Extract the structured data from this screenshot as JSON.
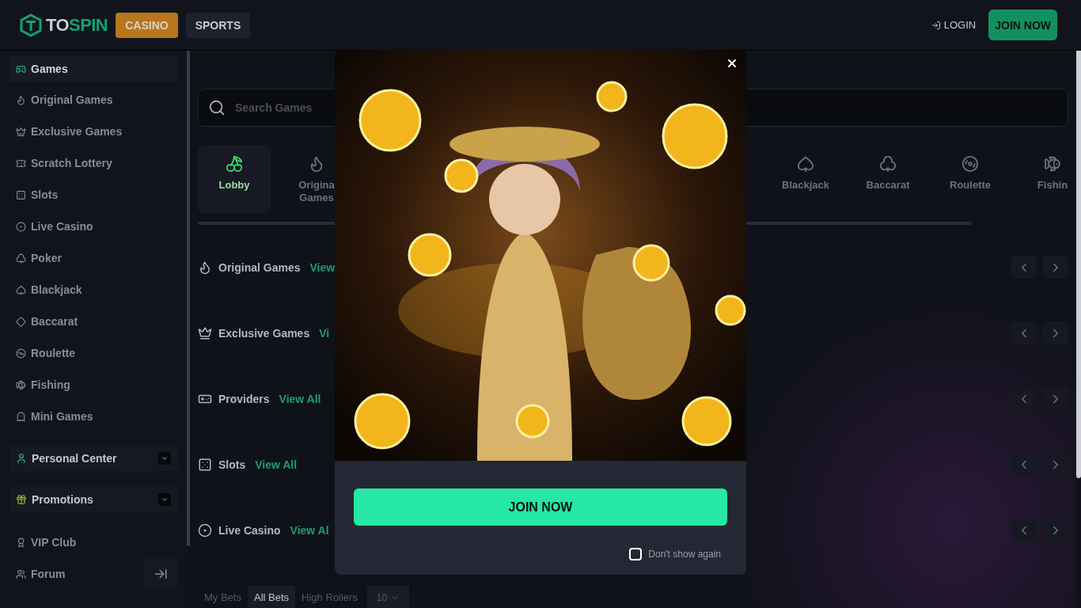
{
  "header": {
    "logo": {
      "parts": [
        "TO",
        "SPIN"
      ]
    },
    "nav": [
      {
        "label": "CASINO",
        "selected": true
      },
      {
        "label": "SPORTS",
        "selected": false
      }
    ],
    "login": "LOGIN",
    "join": "JOIN NOW"
  },
  "sidebar": {
    "items": [
      {
        "label": "Games",
        "selected": true
      },
      {
        "label": "Original Games",
        "selected": false
      },
      {
        "label": "Exclusive Games",
        "selected": false
      },
      {
        "label": "Scratch Lottery",
        "selected": false
      },
      {
        "label": "Slots",
        "selected": false
      },
      {
        "label": "Live Casino",
        "selected": false
      },
      {
        "label": "Poker",
        "selected": false
      },
      {
        "label": "Blackjack",
        "selected": false
      },
      {
        "label": "Baccarat",
        "selected": false
      },
      {
        "label": "Roulette",
        "selected": false
      },
      {
        "label": "Fishing",
        "selected": false
      },
      {
        "label": "Mini Games",
        "selected": false
      }
    ],
    "groups": [
      {
        "label": "Personal Center",
        "expanded": false
      },
      {
        "label": "Promotions",
        "expanded": false
      }
    ],
    "links": [
      {
        "label": "VIP Club"
      },
      {
        "label": "Forum"
      }
    ]
  },
  "search": {
    "placeholder": "Search Games"
  },
  "categories_left": [
    {
      "label": "Lobby",
      "selected": true
    },
    {
      "label": "Origina Games",
      "selected": false
    }
  ],
  "categories_right": [
    {
      "label": "Blackjack",
      "selected": false
    },
    {
      "label": "Baccarat",
      "selected": false
    },
    {
      "label": "Roulette",
      "selected": false
    },
    {
      "label": "Fishin",
      "selected": false
    }
  ],
  "sections": [
    {
      "title": "Original Games",
      "link": "View"
    },
    {
      "title": "Exclusive Games",
      "link": "Vi"
    },
    {
      "title": "Providers",
      "link": "View All"
    },
    {
      "title": "Slots",
      "link": "View All"
    },
    {
      "title": "Live Casino",
      "link": "View Al"
    }
  ],
  "bets": {
    "tabs": [
      {
        "label": "My Bets",
        "selected": false
      },
      {
        "label": "All Bets",
        "selected": true
      },
      {
        "label": "High Rollers",
        "selected": false
      }
    ],
    "page_size": "10"
  },
  "modal": {
    "join": "JOIN NOW",
    "dont_show": {
      "label": "Don't show again",
      "checked": false
    }
  }
}
